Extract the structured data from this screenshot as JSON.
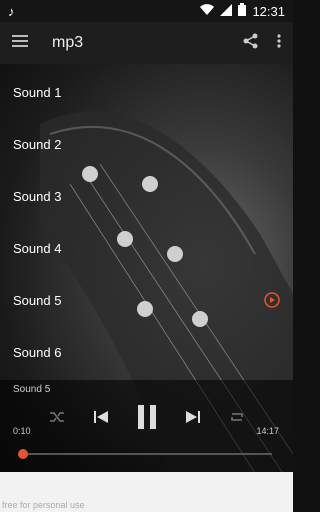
{
  "status_bar": {
    "time": "12:31",
    "icons": [
      "music-note-icon",
      "wifi-icon",
      "signal-icon",
      "battery-icon"
    ]
  },
  "app_bar": {
    "title": "mp3",
    "icons": [
      "menu-icon",
      "share-icon",
      "more-vert-icon"
    ]
  },
  "sounds": [
    {
      "label": "Sound 1",
      "playing": false
    },
    {
      "label": "Sound 2",
      "playing": false
    },
    {
      "label": "Sound 3",
      "playing": false
    },
    {
      "label": "Sound 4",
      "playing": false
    },
    {
      "label": "Sound 5",
      "playing": true
    },
    {
      "label": "Sound 6",
      "playing": false
    }
  ],
  "player": {
    "now_playing": "Sound 5",
    "elapsed": "0:10",
    "total": "14:17",
    "progress": 0.01,
    "icons": [
      "shuffle-icon",
      "previous-icon",
      "pause-icon",
      "next-icon",
      "repeat-icon"
    ]
  },
  "footer": {
    "note": "free for personal use"
  },
  "colors": {
    "accent": "#e4552e",
    "background": "#111111"
  }
}
